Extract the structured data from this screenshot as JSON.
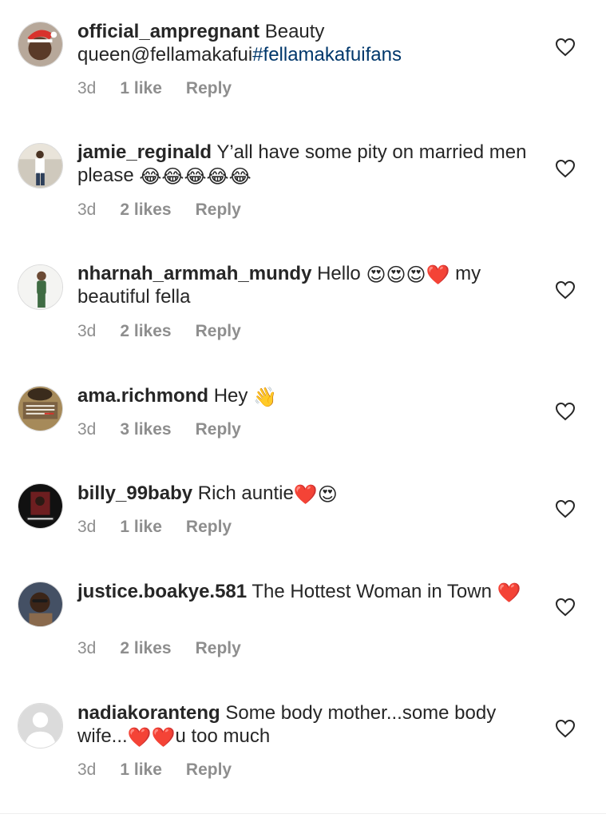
{
  "comments": [
    {
      "username": "official_ampregnant",
      "text_before": " Beauty queen@fellamakafui",
      "hashtag": "#fellamakafuifans",
      "emojis": "",
      "text_after": "",
      "time": "3d",
      "likes": "1 like",
      "reply": "Reply"
    },
    {
      "username": "jamie_reginald",
      "text_before": " Y’all have some pity on married men please ",
      "hashtag": "",
      "emojis": "😂😂😂😂😂",
      "text_after": "",
      "time": "3d",
      "likes": "2 likes",
      "reply": "Reply"
    },
    {
      "username": "nharnah_armmah_mundy",
      "text_before": " Hello ",
      "hashtag": "",
      "emojis": "😍😍😍❤️",
      "text_after": " my beautiful fella",
      "time": "3d",
      "likes": "2 likes",
      "reply": "Reply"
    },
    {
      "username": "ama.richmond",
      "text_before": " Hey ",
      "hashtag": "",
      "emojis": "👋",
      "text_after": "",
      "time": "3d",
      "likes": "3 likes",
      "reply": "Reply"
    },
    {
      "username": "billy_99baby",
      "text_before": " Rich auntie",
      "hashtag": "",
      "emojis": "❤️😍",
      "text_after": "",
      "time": "3d",
      "likes": "1 like",
      "reply": "Reply"
    },
    {
      "username": "justice.boakye.581",
      "text_before": " The Hottest Woman in Town ",
      "hashtag": "",
      "emojis": "❤️",
      "text_after": "",
      "time": "3d",
      "likes": "2 likes",
      "reply": "Reply"
    },
    {
      "username": "nadiakoranteng",
      "text_before": " Some body mother...some body wife...",
      "hashtag": "",
      "emojis": "❤️❤️",
      "text_after": "u too much",
      "time": "3d",
      "likes": "1 like",
      "reply": "Reply"
    }
  ],
  "icons": {
    "like": "heart-outline-icon",
    "default_avatar": "default-avatar-icon"
  },
  "colors": {
    "text": "#262626",
    "secondary": "#8e8e8e",
    "link": "#00376b",
    "divider": "#efefef"
  }
}
